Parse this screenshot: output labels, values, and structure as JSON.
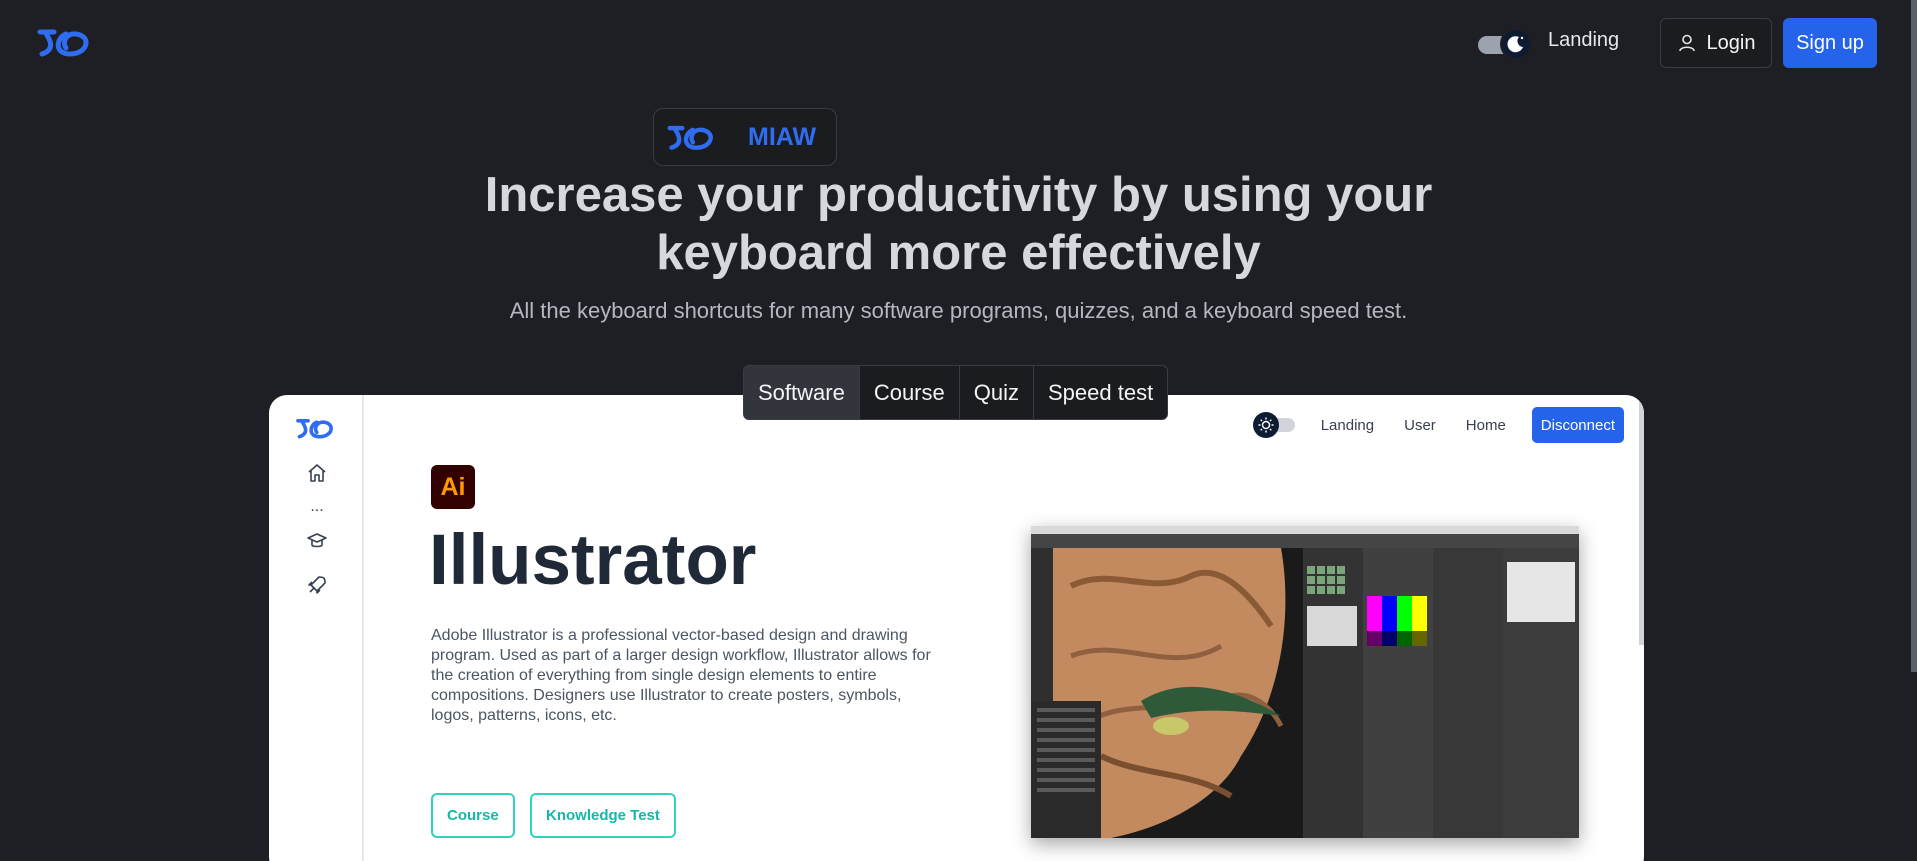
{
  "header": {
    "nav_landing": "Landing",
    "login_label": "Login",
    "signup_label": "Sign up"
  },
  "hero": {
    "badge_text": "MIAW",
    "title_line1": "Increase your productivity by using your",
    "title_line2": "keyboard more effectively",
    "subtitle": "All the keyboard shortcuts for many software programs, quizzes, and a keyboard speed test."
  },
  "tabs": [
    {
      "label": "Software"
    },
    {
      "label": "Course"
    },
    {
      "label": "Quiz"
    },
    {
      "label": "Speed test"
    }
  ],
  "preview": {
    "nav": {
      "landing": "Landing",
      "user": "User",
      "home": "Home",
      "disconnect": "Disconnect"
    },
    "app_icon_text": "Ai",
    "app_title": "Illustrator",
    "app_description": "Adobe Illustrator is a professional vector-based design and drawing program. Used as part of a larger design workflow, Illustrator allows for the creation of everything from single design elements to entire compositions. Designers use Illustrator to create posters, symbols, logos, patterns, icons, etc.",
    "course_button": "Course",
    "knowledge_button": "Knowledge Test",
    "sidebar_more": "..."
  },
  "colors": {
    "background": "#1e1f24",
    "accent": "#2563eb",
    "teal": "#14b8a6"
  }
}
